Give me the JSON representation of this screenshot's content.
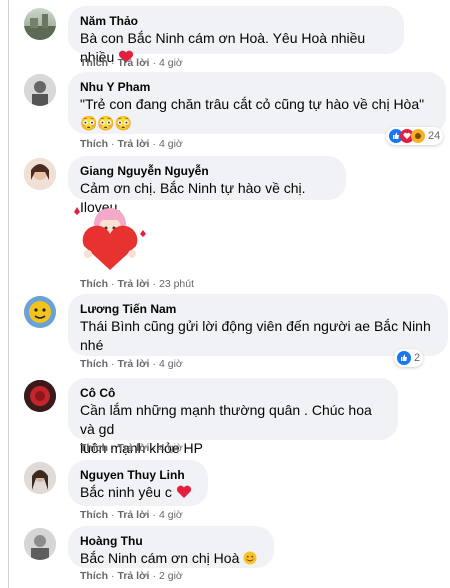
{
  "actions": {
    "like": "Thích",
    "reply": "Trả lời",
    "sep": "·"
  },
  "comments": [
    {
      "author": "Năm Thảo",
      "text": "Bà con Bắc Ninh cám ơn Hoà. Yêu Hoà nhiều nhiều",
      "time": "4 giờ",
      "emoji": "heart-emoji"
    },
    {
      "author": "Nhu Y Pham",
      "text": "\"Trẻ con đang chăn trâu cắt cỏ cũng tự hào về chị Hòa\"",
      "emoji_line": "😳😳😳",
      "time": "4 giờ",
      "reaction_count": "24"
    },
    {
      "author": "Giang Nguyễn Nguyễn",
      "text": "Cảm ơn chị. Bắc Ninh tự hào về chị. Iloveu.",
      "time": "23 phút",
      "sticker": "girl-heart-sticker"
    },
    {
      "author": "Lương Tiến Nam",
      "text_lines": [
        "Thái Bình cũng gửi lời động viên đến người ae Bắc Ninh",
        "nhé"
      ],
      "time": "4 giờ",
      "reaction_count": "2"
    },
    {
      "author": "Cô Cô",
      "text_lines": [
        "Cần lắm những mạnh thường quân . Chúc hoa và gd",
        "luôn mạnh khỏe HP"
      ],
      "time": "4 giờ"
    },
    {
      "author": "Nguyen Thuy Linh",
      "text": "Bắc ninh yêu c",
      "time": "4 giờ",
      "emoji": "heart-emoji"
    },
    {
      "author": "Hoàng Thu",
      "text": "Bắc Ninh cám ơn chị Hoà",
      "time": "2 giờ",
      "emoji": "smile-emoji"
    }
  ],
  "colors": {
    "bubble": "#f0f2f5",
    "meta": "#65676b",
    "like_blue": "#1877f2",
    "heart_red": "#e41e3f",
    "haha_yellow": "#f7b125"
  }
}
